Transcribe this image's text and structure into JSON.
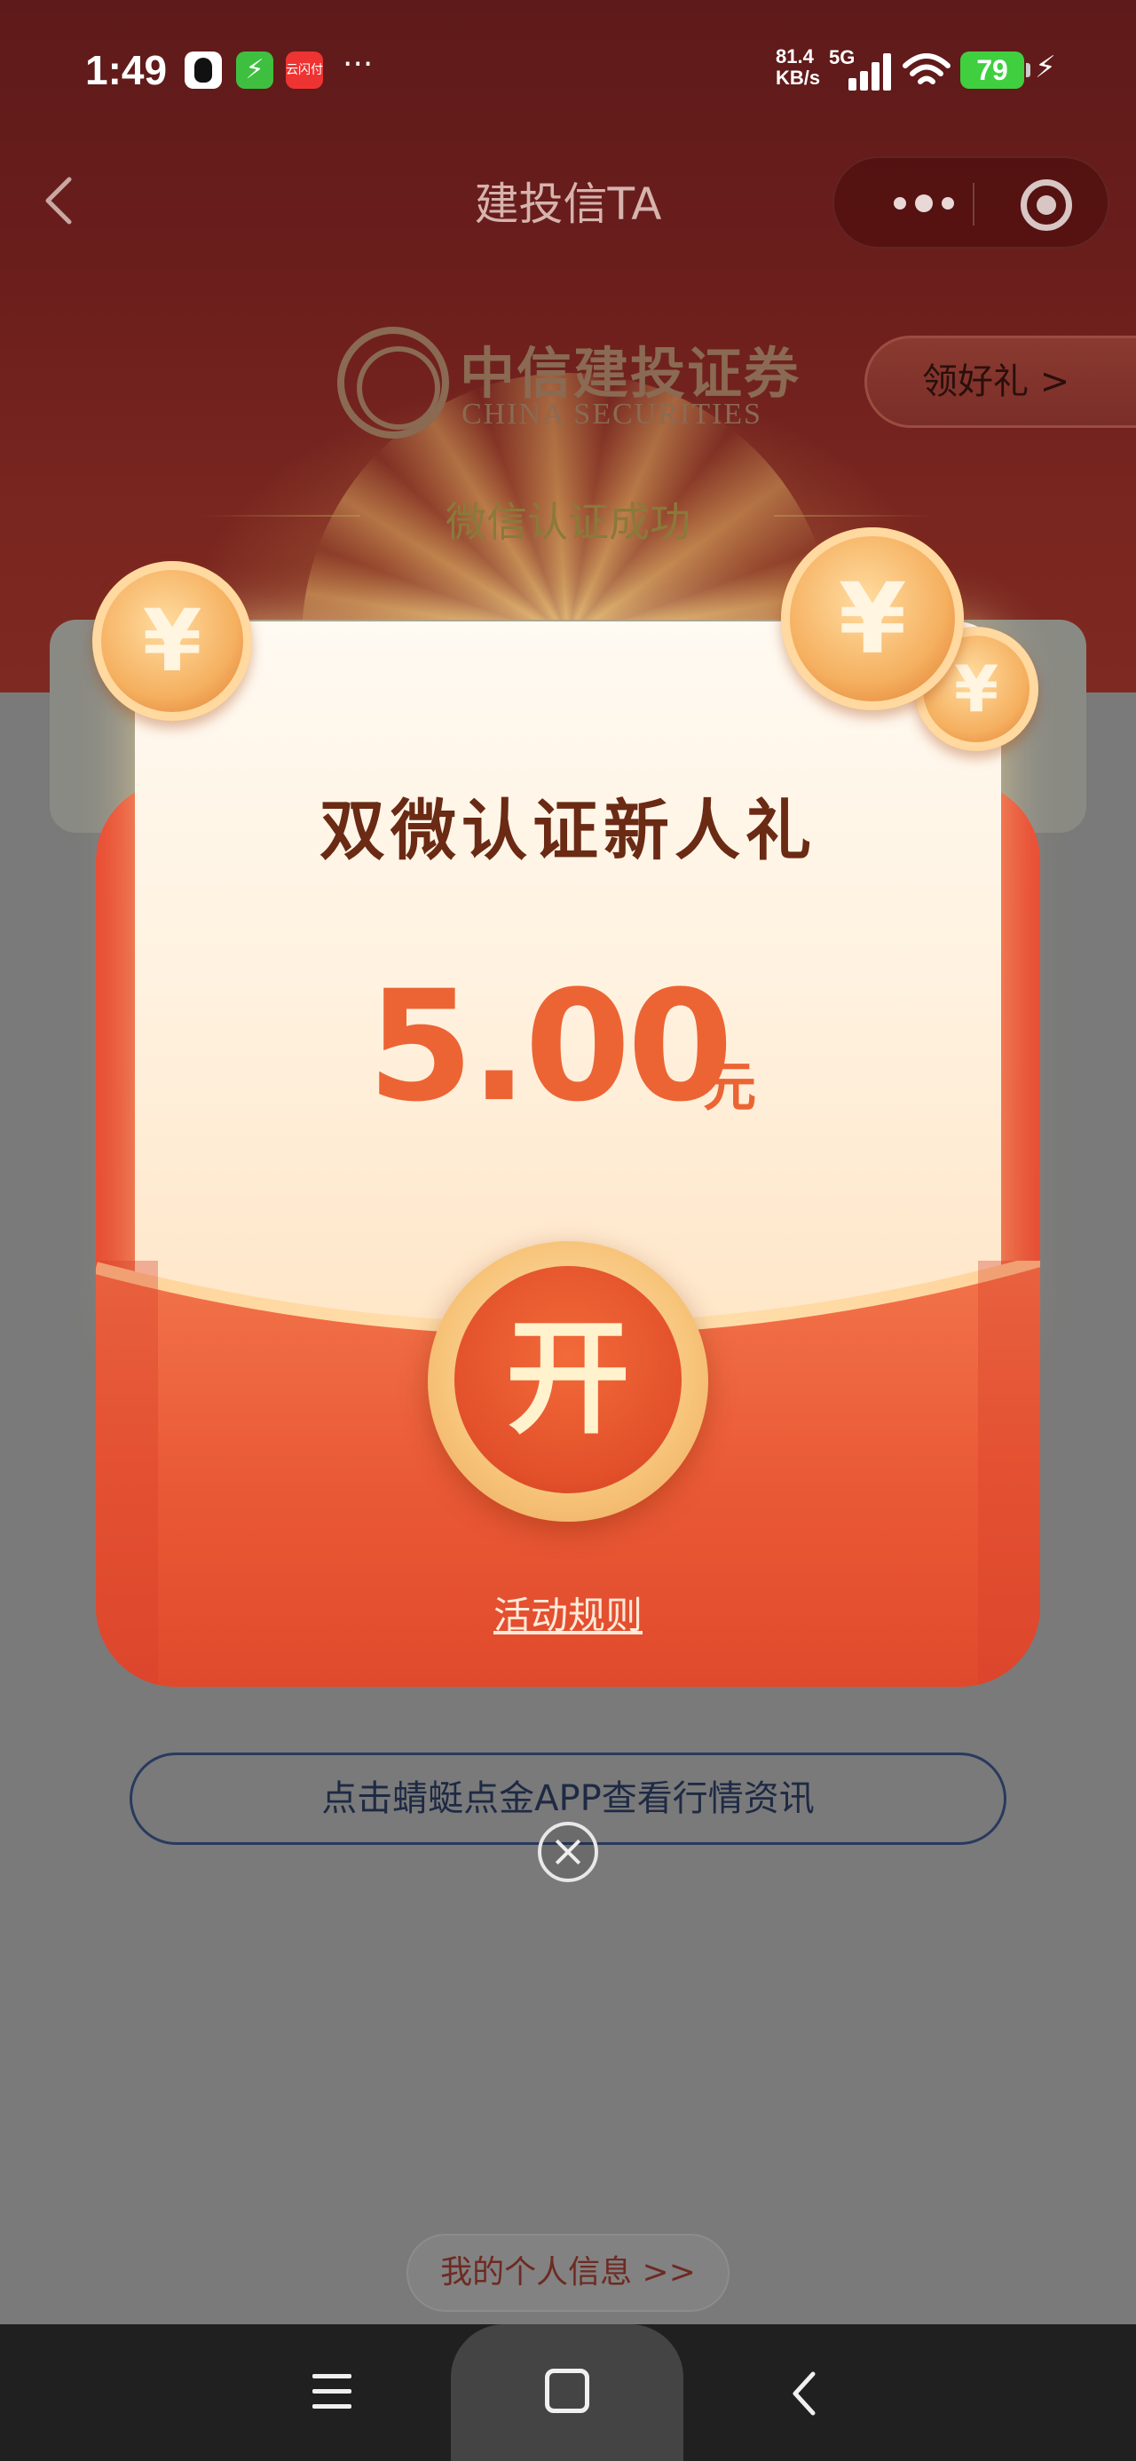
{
  "status_bar": {
    "time": "1:49",
    "net_speed_value": "81.4",
    "net_speed_unit": "KB/s",
    "net_type": "5G",
    "more": "···",
    "battery": "79",
    "pay_badge": "云闪付",
    "icons": [
      "qq-icon",
      "bolt-icon",
      "pay-icon",
      "signal-icon",
      "wifi-icon",
      "battery-icon",
      "charging-icon"
    ]
  },
  "nav": {
    "title": "建投信TA"
  },
  "brand": {
    "name_cn": "中信建投证券",
    "name_en": "CHINA SECURITIES",
    "get_gift": "领好礼 >",
    "auth_success": "微信认证成功"
  },
  "packet": {
    "title": "双微认证新人礼",
    "amount": "5.00",
    "unit": "元",
    "open_label": "开",
    "rules_link": "活动规则",
    "coin_symbol": "¥"
  },
  "info_pill": "点击蜻蜓点金APP查看行情资讯",
  "bottom_link": "我的个人信息 >>",
  "colors": {
    "hero_red": "#6b1e1c",
    "packet_red": "#e84a32",
    "amount_orange": "#ec6434",
    "title_brown": "#6a2a14",
    "overlay_gray": "#7a7a7a"
  }
}
